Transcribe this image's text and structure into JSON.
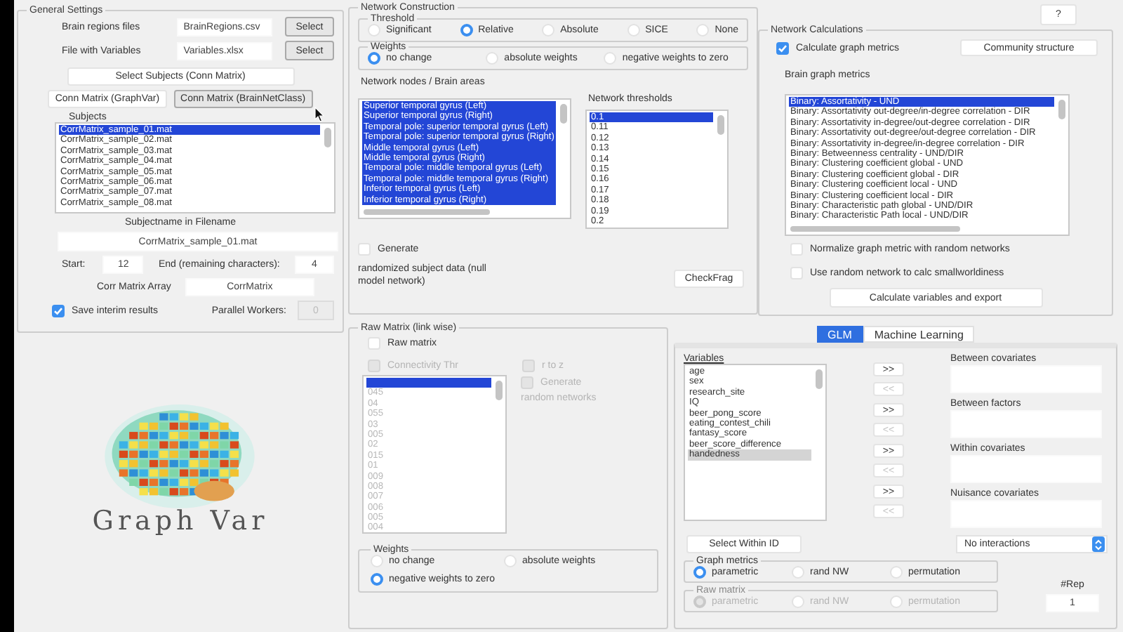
{
  "general_settings": {
    "title": "General Settings",
    "files": [
      {
        "label": "Brain regions files",
        "value": "BrainRegions.csv",
        "button": "Select"
      },
      {
        "label": "File with Variables",
        "value": "Variables.xlsx",
        "button": "Select"
      }
    ],
    "select_subjects_button": "Select Subjects (Conn Matrix)",
    "conn_buttons": [
      {
        "label": "Conn Matrix (GraphVar)",
        "selected": false
      },
      {
        "label": "Conn Matrix (BrainNetClass)",
        "selected": true
      }
    ],
    "subjects_title": "Subjects",
    "subjects": [
      {
        "label": "CorrMatrix_sample_01.mat",
        "selected": true
      },
      {
        "label": "CorrMatrix_sample_02.mat",
        "selected": false
      },
      {
        "label": "CorrMatrix_sample_03.mat",
        "selected": false
      },
      {
        "label": "CorrMatrix_sample_04.mat",
        "selected": false
      },
      {
        "label": "CorrMatrix_sample_05.mat",
        "selected": false
      },
      {
        "label": "CorrMatrix_sample_06.mat",
        "selected": false
      },
      {
        "label": "CorrMatrix_sample_07.mat",
        "selected": false
      },
      {
        "label": "CorrMatrix_sample_08.mat",
        "selected": false
      }
    ],
    "subjectname_title": "Subjectname in Filename",
    "subjectname_value": "CorrMatrix_sample_01.mat",
    "start_label": "Start:",
    "start_value": "12",
    "end_label": "End (remaining characters):",
    "end_value": "4",
    "array_label": "Corr Matrix Array",
    "array_value": "CorrMatrix",
    "save_interim": {
      "label": "Save interim results",
      "checked": true
    },
    "parallel_label": "Parallel Workers:",
    "parallel_value": "0",
    "parallel_disabled": true
  },
  "logo": {
    "text": "Graph Var"
  },
  "network_construction": {
    "title": "Network Construction",
    "threshold": {
      "title": "Threshold",
      "options": [
        {
          "label": "Significant",
          "selected": false
        },
        {
          "label": "Relative",
          "selected": true
        },
        {
          "label": "Absolute",
          "selected": false
        },
        {
          "label": "SICE",
          "selected": false
        },
        {
          "label": "None",
          "selected": false
        }
      ]
    },
    "weights": {
      "title": "Weights",
      "options": [
        {
          "label": "no change",
          "selected": true
        },
        {
          "label": "absolute weights",
          "selected": false
        },
        {
          "label": "negative weights to zero",
          "selected": false
        }
      ]
    },
    "nodes_title": "Network nodes / Brain areas",
    "nodes": [
      {
        "label": "Superior temporal gyrus (Left)",
        "selected": true
      },
      {
        "label": "Superior temporal gyrus (Right)",
        "selected": true
      },
      {
        "label": "Temporal pole: superior temporal gyrus (Left)",
        "selected": true
      },
      {
        "label": "Temporal pole: superior temporal gyrus (Right)",
        "selected": true
      },
      {
        "label": "Middle temporal gyrus (Left)",
        "selected": true
      },
      {
        "label": "Middle temporal gyrus (Right)",
        "selected": true
      },
      {
        "label": "Temporal pole: middle temporal gyrus (Left)",
        "selected": true
      },
      {
        "label": "Temporal pole: middle temporal gyrus (Right)",
        "selected": true
      },
      {
        "label": "Inferior temporal gyrus (Left)",
        "selected": true
      },
      {
        "label": "Inferior temporal gyrus (Right)",
        "selected": true
      }
    ],
    "thresholds_title": "Network thresholds",
    "thresholds": [
      {
        "label": "0.1",
        "selected": true
      },
      {
        "label": "0.11",
        "selected": false
      },
      {
        "label": "0.12",
        "selected": false
      },
      {
        "label": "0.13",
        "selected": false
      },
      {
        "label": "0.14",
        "selected": false
      },
      {
        "label": "0.15",
        "selected": false
      },
      {
        "label": "0.16",
        "selected": false
      },
      {
        "label": "0.17",
        "selected": false
      },
      {
        "label": "0.18",
        "selected": false
      },
      {
        "label": "0.19",
        "selected": false
      },
      {
        "label": "0.2",
        "selected": false
      }
    ],
    "generate": {
      "label": "Generate",
      "checked": false
    },
    "generate_note": "randomized subject data (null model network)",
    "checkfrag_button": "CheckFrag"
  },
  "help_button": "?",
  "network_calculations": {
    "title": "Network Calculations",
    "calc_metrics": {
      "label": "Calculate graph metrics",
      "checked": true
    },
    "community_button": "Community structure",
    "metrics_title": "Brain graph metrics",
    "metrics": [
      {
        "label": "Binary: Assortativity - UND",
        "selected": true
      },
      {
        "label": "Binary: Assortativity out-degree/in-degree correlation - DIR",
        "selected": false
      },
      {
        "label": "Binary: Assortativity in-degree/out-degree correlation - DIR",
        "selected": false
      },
      {
        "label": "Binary: Assortativity out-degree/out-degree correlation - DIR",
        "selected": false
      },
      {
        "label": "Binary: Assortativity in-degree/in-degree correlation - DIR",
        "selected": false
      },
      {
        "label": "Binary: Betweenness centrality - UND/DIR",
        "selected": false
      },
      {
        "label": "Binary: Clustering coefficient global - UND",
        "selected": false
      },
      {
        "label": "Binary: Clustering coefficient global - DIR",
        "selected": false
      },
      {
        "label": "Binary: Clustering coefficient local - UND",
        "selected": false
      },
      {
        "label": "Binary: Clustering coefficient local - DIR",
        "selected": false
      },
      {
        "label": "Binary: Characteristic path global - UND/DIR",
        "selected": false
      },
      {
        "label": "Binary: Characteristic Path local - UND/DIR",
        "selected": false
      }
    ],
    "normalize": {
      "label": "Normalize graph metric with random networks",
      "checked": false
    },
    "smallworld": {
      "label": "Use random network to calc smallworldiness",
      "checked": false
    },
    "calc_button": "Calculate variables and export"
  },
  "raw_matrix": {
    "title": "Raw Matrix (link wise)",
    "raw": {
      "label": "Raw matrix",
      "checked": false,
      "disabled": false
    },
    "connectivity": {
      "label": "Connectivity Thr",
      "checked": false,
      "disabled": true
    },
    "r_to_z": {
      "label": "r to z",
      "checked": false,
      "disabled": true
    },
    "list_disabled": true,
    "blank_selected_row": true,
    "items": [
      {
        "label": "045",
        "selected": false
      },
      {
        "label": "04",
        "selected": false
      },
      {
        "label": "055",
        "selected": false
      },
      {
        "label": "03",
        "selected": false
      },
      {
        "label": "005",
        "selected": false
      },
      {
        "label": "02",
        "selected": false
      },
      {
        "label": "015",
        "selected": false
      },
      {
        "label": "01",
        "selected": false
      },
      {
        "label": "009",
        "selected": false
      },
      {
        "label": "008",
        "selected": false
      },
      {
        "label": "007",
        "selected": false
      },
      {
        "label": "006",
        "selected": false
      },
      {
        "label": "005",
        "selected": false
      },
      {
        "label": "004",
        "selected": false
      }
    ],
    "generate": {
      "label": "Generate",
      "checked": false,
      "disabled": true
    },
    "generate_note": "random networks",
    "weights": {
      "title": "Weights",
      "options": [
        {
          "label": "no change",
          "selected": false
        },
        {
          "label": "absolute weights",
          "selected": false
        },
        {
          "label": "negative weights to zero",
          "selected": true
        }
      ]
    }
  },
  "glm": {
    "tabs": [
      {
        "label": "GLM",
        "selected": true
      },
      {
        "label": "Machine Learning",
        "selected": false
      }
    ],
    "variables_title": "Variables",
    "variables": [
      {
        "label": "age",
        "selected": false
      },
      {
        "label": "sex",
        "selected": false
      },
      {
        "label": "research_site",
        "selected": false
      },
      {
        "label": "IQ",
        "selected": false
      },
      {
        "label": "beer_pong_score",
        "selected": false
      },
      {
        "label": "eating_contest_chili",
        "selected": false
      },
      {
        "label": "fantasy_score",
        "selected": false
      },
      {
        "label": "beer_score_difference",
        "selected": false
      },
      {
        "label": "handedness",
        "selected": true
      }
    ],
    "groups": [
      {
        "title": "Between covariates",
        "add": {
          "label": ">>",
          "disabled": false
        },
        "remove": {
          "label": "<<",
          "disabled": true
        }
      },
      {
        "title": "Between factors",
        "add": {
          "label": ">>",
          "disabled": false
        },
        "remove": {
          "label": "<<",
          "disabled": true
        }
      },
      {
        "title": "Within covariates",
        "add": {
          "label": ">>",
          "disabled": false
        },
        "remove": {
          "label": "<<",
          "disabled": true
        }
      },
      {
        "title": "Nuisance covariates",
        "add": {
          "label": ">>",
          "disabled": false
        },
        "remove": {
          "label": "<<",
          "disabled": true
        }
      }
    ],
    "select_within_button": "Select Within ID",
    "interactions": "No interactions",
    "graph_metrics": {
      "title": "Graph metrics",
      "disabled": false,
      "options": [
        {
          "label": "parametric",
          "selected": true
        },
        {
          "label": "rand NW",
          "selected": false
        },
        {
          "label": "permutation",
          "selected": false
        }
      ]
    },
    "raw_matrix": {
      "title": "Raw matrix",
      "disabled": true,
      "options": [
        {
          "label": "parametric",
          "selected": true
        },
        {
          "label": "rand NW",
          "selected": false
        },
        {
          "label": "permutation",
          "selected": false
        }
      ]
    },
    "rep_label": "#Rep",
    "rep_value": "1"
  }
}
